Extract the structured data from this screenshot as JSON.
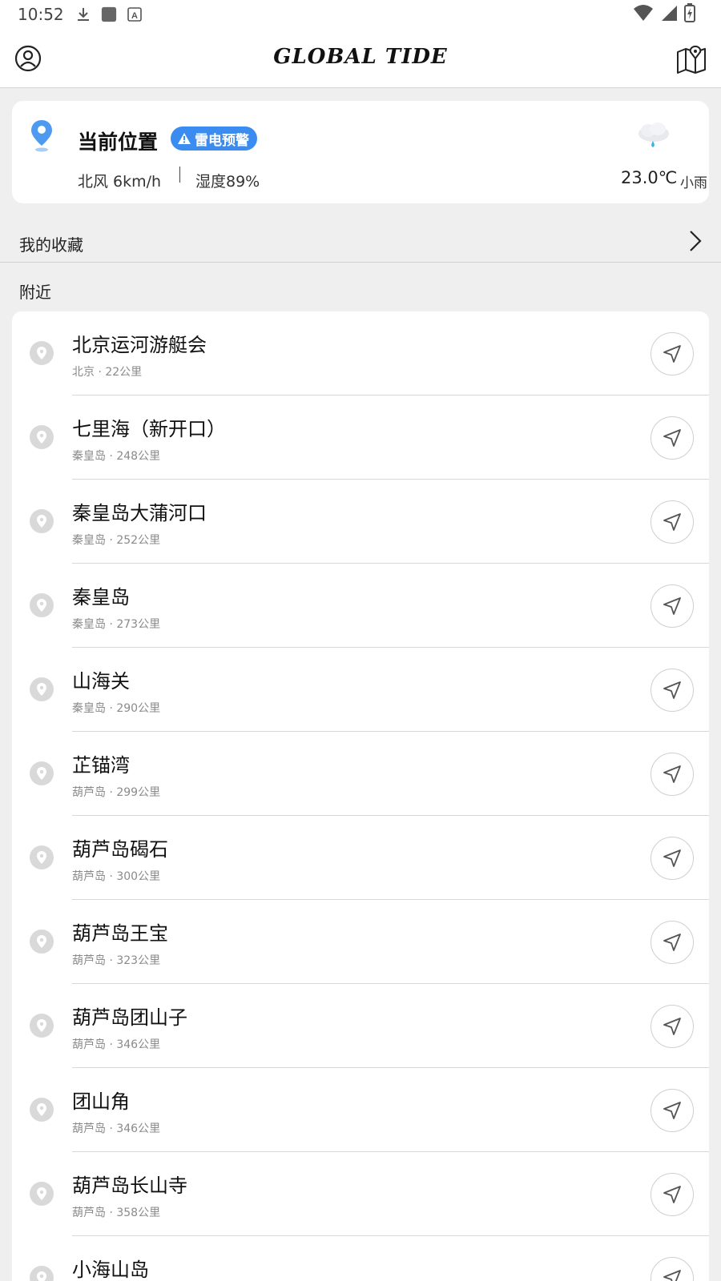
{
  "status_bar": {
    "time": "10:52",
    "icons": [
      "download-icon",
      "app-square-icon",
      "font-a-icon",
      "wifi-icon",
      "signal-icon",
      "battery-charging-icon"
    ]
  },
  "header": {
    "brand": "GLOBAL TIDE",
    "left_icon": "user-circle-icon",
    "right_icon": "map-pin-icon"
  },
  "weather": {
    "location": "当前位置",
    "alert": "雷电预警",
    "wind": "北风 6km/h",
    "humidity": "湿度89%",
    "temperature": "23.0℃",
    "condition": "小雨",
    "accent_color": "#3b8cf0"
  },
  "favorites": {
    "label": "我的收藏"
  },
  "nearby": {
    "label": "附近",
    "items": [
      {
        "name": "北京运河游艇会",
        "meta": "北京 · 22公里"
      },
      {
        "name": "七里海（新开口）",
        "meta": "秦皇岛 · 248公里"
      },
      {
        "name": "秦皇岛大蒲河口",
        "meta": "秦皇岛 · 252公里"
      },
      {
        "name": "秦皇岛",
        "meta": "秦皇岛 · 273公里"
      },
      {
        "name": "山海关",
        "meta": "秦皇岛 · 290公里"
      },
      {
        "name": "芷锚湾",
        "meta": "葫芦岛 · 299公里"
      },
      {
        "name": "葫芦岛碣石",
        "meta": "葫芦岛 · 300公里"
      },
      {
        "name": "葫芦岛王宝",
        "meta": "葫芦岛 · 323公里"
      },
      {
        "name": "葫芦岛团山子",
        "meta": "葫芦岛 · 346公里"
      },
      {
        "name": "团山角",
        "meta": "葫芦岛 · 346公里"
      },
      {
        "name": "葫芦岛长山寺",
        "meta": "葫芦岛 · 358公里"
      },
      {
        "name": "小海山岛",
        "meta": ""
      }
    ]
  }
}
